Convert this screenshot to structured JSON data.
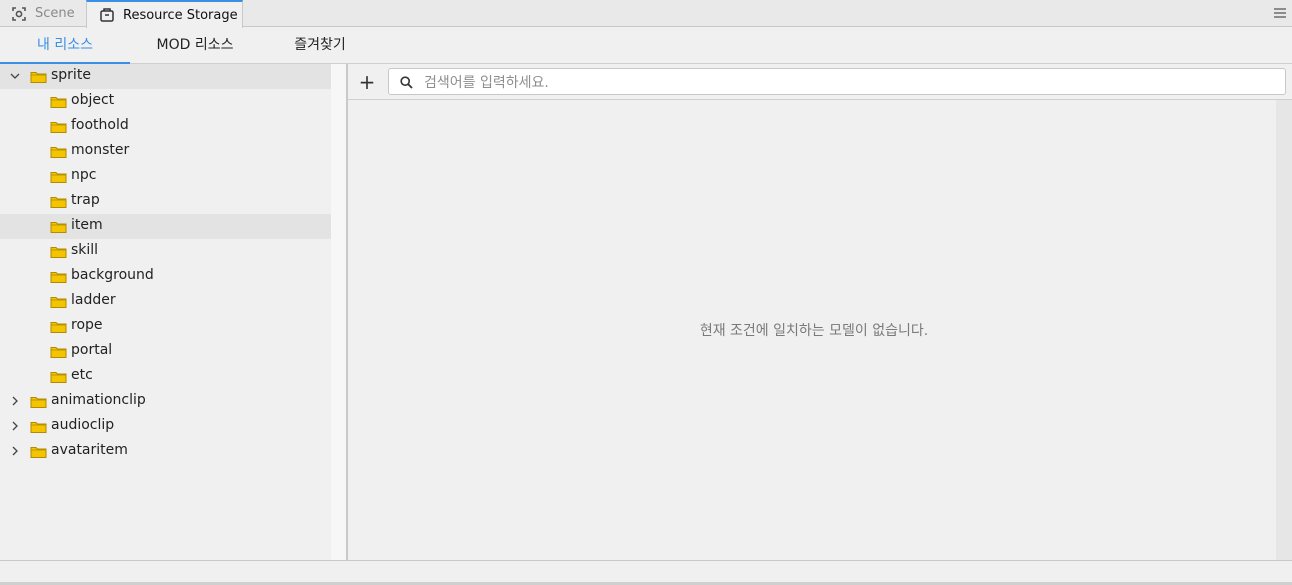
{
  "tabs": {
    "scene": "Scene",
    "resource_storage": "Resource Storage"
  },
  "subtabs": [
    "내 리소스",
    "MOD 리소스",
    "즐겨찾기"
  ],
  "tree": {
    "root": {
      "label": "sprite",
      "expanded": true,
      "children": [
        "object",
        "foothold",
        "monster",
        "npc",
        "trap",
        "item",
        "skill",
        "background",
        "ladder",
        "rope",
        "portal",
        "etc"
      ]
    },
    "collapsed": [
      "animationclip",
      "audioclip",
      "avataritem"
    ]
  },
  "search": {
    "placeholder": "검색어를 입력하세요.",
    "value": ""
  },
  "empty_message": "현재 조건에 일치하는 모델이 없습니다.",
  "colors": {
    "accent": "#3a8ee6",
    "folder": "#f5c400"
  }
}
